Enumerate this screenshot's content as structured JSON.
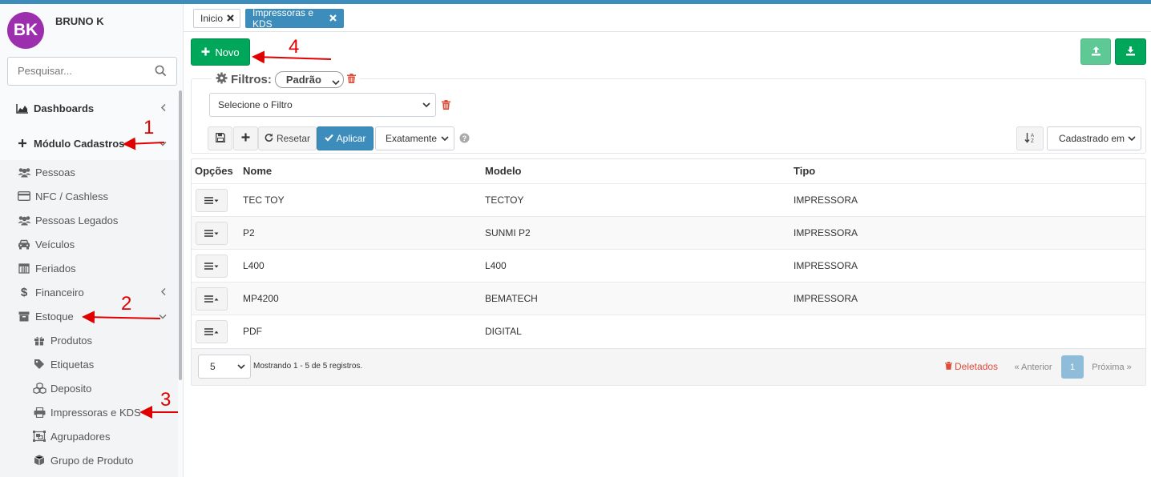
{
  "user": {
    "initials": "BK",
    "name": "BRUNO K"
  },
  "search": {
    "placeholder": "Pesquisar..."
  },
  "sidebar": {
    "dashboards": "Dashboards",
    "modulo": "Módulo Cadastros",
    "items": [
      {
        "label": "Pessoas",
        "icon": "users-icon"
      },
      {
        "label": "NFC / Cashless",
        "icon": "credit-card-icon"
      },
      {
        "label": "Pessoas Legados",
        "icon": "users-icon"
      },
      {
        "label": "Veículos",
        "icon": "car-icon"
      },
      {
        "label": "Feriados",
        "icon": "calendar-icon"
      },
      {
        "label": "Financeiro",
        "icon": "dollar-icon"
      },
      {
        "label": "Estoque",
        "icon": "archive-icon"
      }
    ],
    "estoque_items": [
      {
        "label": "Produtos",
        "icon": "gift-icon"
      },
      {
        "label": "Etiquetas",
        "icon": "tag-icon"
      },
      {
        "label": "Deposito",
        "icon": "cubes-icon"
      },
      {
        "label": "Impressoras e KDS",
        "icon": "print-icon"
      },
      {
        "label": "Agrupadores",
        "icon": "object-group-icon"
      },
      {
        "label": "Grupo de Produto",
        "icon": "cube-icon"
      }
    ]
  },
  "tabs": [
    {
      "label": "Inicio"
    },
    {
      "label": "Impressoras e KDS"
    }
  ],
  "toolbar": {
    "novo": "Novo"
  },
  "filters": {
    "legend": "Filtros:",
    "preset": "Padrão",
    "select_placeholder": "Selecione o Filtro",
    "reset": "Resetar",
    "apply": "Aplicar",
    "match": "Exatamente",
    "sort": "Cadastrado em"
  },
  "table": {
    "headers": [
      "Opções",
      "Nome",
      "Modelo",
      "Tipo"
    ],
    "rows": [
      {
        "nome": "TEC TOY",
        "modelo": "TECTOY",
        "tipo": "IMPRESSORA"
      },
      {
        "nome": "P2",
        "modelo": "SUNMI P2",
        "tipo": "IMPRESSORA"
      },
      {
        "nome": "L400",
        "modelo": "L400",
        "tipo": "IMPRESSORA"
      },
      {
        "nome": "MP4200",
        "modelo": "BEMATECH",
        "tipo": "IMPRESSORA"
      },
      {
        "nome": "PDF",
        "modelo": "DIGITAL",
        "tipo": ""
      }
    ]
  },
  "pagination": {
    "page_size": "5",
    "info": "Mostrando 1 - 5 de 5 registros.",
    "deleted": "Deletados",
    "prev": "« Anterior",
    "current": "1",
    "next": "Próxima »"
  },
  "annotations": [
    "1",
    "2",
    "3",
    "4"
  ],
  "colors": {
    "primary": "#3c8dbc",
    "success": "#00a65a",
    "danger": "#dd4b39",
    "avatar": "#9b2fae",
    "annotation": "#e00000"
  }
}
